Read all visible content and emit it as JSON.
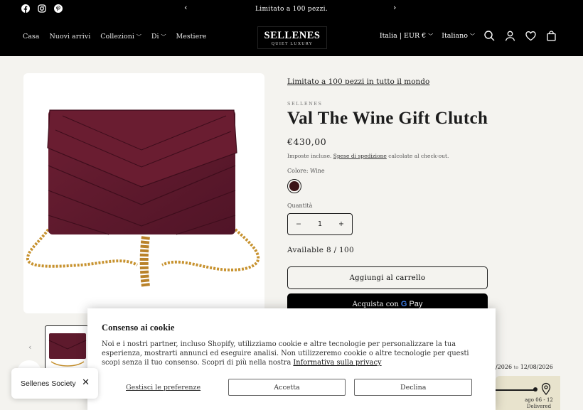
{
  "announcement": {
    "text": "Limitato a 100 pezzi.",
    "prev_icon": "chevron-left-icon",
    "next_icon": "chevron-right-icon",
    "social": [
      "facebook-icon",
      "instagram-icon",
      "pinterest-icon"
    ]
  },
  "header": {
    "nav": [
      {
        "label": "Casa",
        "dropdown": false
      },
      {
        "label": "Nuovi arrivi",
        "dropdown": false
      },
      {
        "label": "Collezioni",
        "dropdown": true
      },
      {
        "label": "Di",
        "dropdown": true
      },
      {
        "label": "Mestiere",
        "dropdown": false
      }
    ],
    "logo_main": "SELLENES",
    "logo_sub": "QUIET LUXURY",
    "country": "Italia | EUR €",
    "language": "Italiano",
    "icons": [
      "search-icon",
      "account-icon",
      "wishlist-icon",
      "cart-icon"
    ]
  },
  "product": {
    "limited_link": "Limitato a 100 pezzi in tutto il mondo",
    "vendor": "SELLENES",
    "title": "Val The Wine Gift Clutch",
    "price": "€430,00",
    "tax_prefix": "Imposte incluse.",
    "tax_link": "Spese di spedizione",
    "tax_suffix": "calcolate al check-out.",
    "color_label": "Colore: Wine",
    "color_hex": "#3b1418",
    "quantity_label": "Quantità",
    "quantity_value": "1",
    "minus": "−",
    "plus": "+",
    "available": "Available 8 / 100",
    "add_to_cart": "Aggiungi al carrello",
    "buy_with": "Acquista con",
    "gpay_g": "G",
    "gpay_pay": "Pay"
  },
  "delivery": {
    "range_start": "/2026",
    "range_to": "to",
    "range_end": "12/08/2026",
    "date": "ago 06 - 12",
    "status": "Delivered"
  },
  "cookie": {
    "title": "Consenso ai cookie",
    "body": "Noi e i nostri partner, incluso Shopify, utilizziamo cookie e altre tecnologie per personalizzare la tua esperienza, mostrarti annunci ed eseguire analisi. Non utilizzeremo cookie o altre tecnologie per questi scopi senza il tuo consenso. Scopri di più nella nostra ",
    "privacy_link": "Informativa sulla privacy",
    "manage": "Gestisci le preferenze",
    "accept": "Accetta",
    "decline": "Declina"
  },
  "society": {
    "label": "Sellenes Society",
    "close": "✕"
  },
  "gallery": {
    "thumb_prev": "‹"
  }
}
